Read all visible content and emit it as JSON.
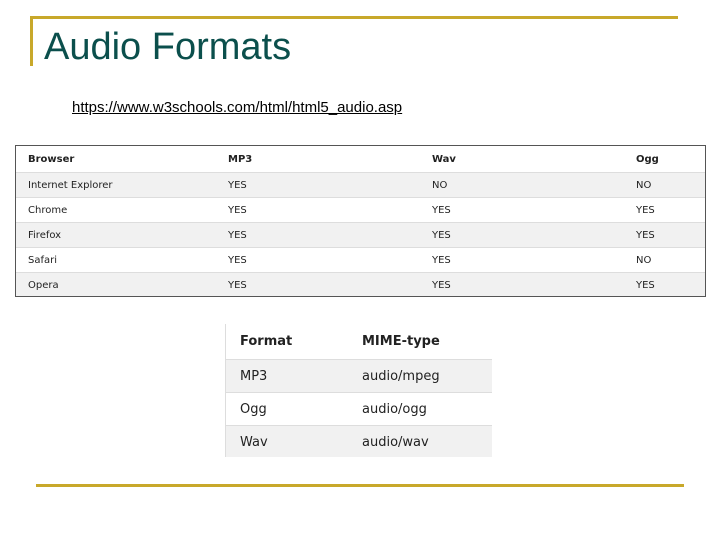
{
  "slide": {
    "title": "Audio Formats",
    "link": "https://www.w3schools.com/html/html5_audio.asp"
  },
  "browser_table": {
    "headers": [
      "Browser",
      "MP3",
      "Wav",
      "Ogg"
    ],
    "rows": [
      [
        "Internet Explorer",
        "YES",
        "NO",
        "NO"
      ],
      [
        "Chrome",
        "YES",
        "YES",
        "YES"
      ],
      [
        "Firefox",
        "YES",
        "YES",
        "YES"
      ],
      [
        "Safari",
        "YES",
        "YES",
        "NO"
      ],
      [
        "Opera",
        "YES",
        "YES",
        "YES"
      ]
    ]
  },
  "mime_table": {
    "headers": [
      "Format",
      "MIME-type"
    ],
    "rows": [
      [
        "MP3",
        "audio/mpeg"
      ],
      [
        "Ogg",
        "audio/ogg"
      ],
      [
        "Wav",
        "audio/wav"
      ]
    ]
  },
  "colors": {
    "accent_rule": "#c8a82a",
    "title": "#0b4f4c",
    "row_stripe": "#f1f1f1"
  }
}
